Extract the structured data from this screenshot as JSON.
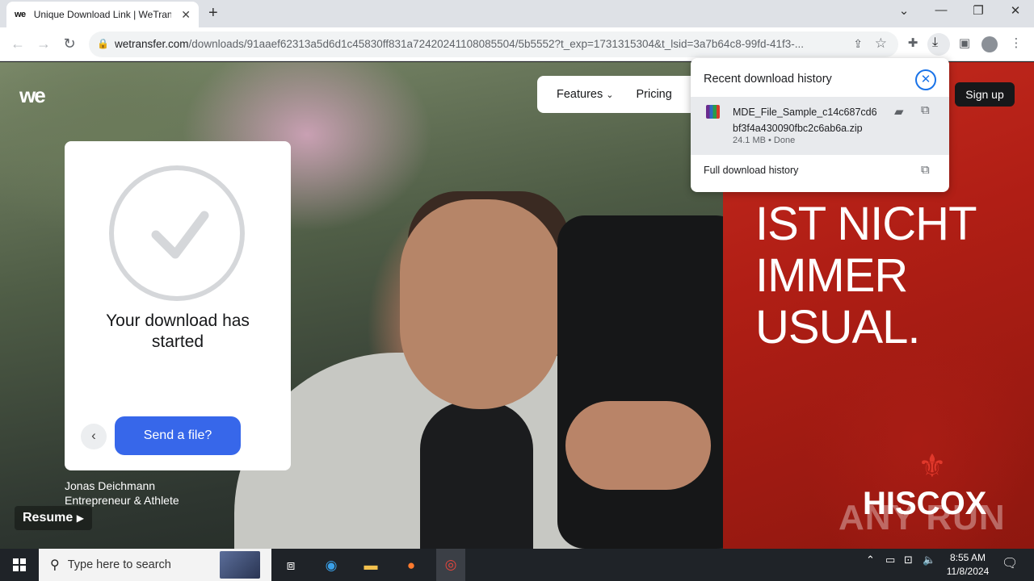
{
  "browser": {
    "tab_title": "Unique Download Link | WeTransfer",
    "tab_favicon": "we",
    "url_host": "wetransfer.com",
    "url_path": "/downloads/91aaef62313a5d6d1c45830ff831a72420241108085504/5b5552?t_exp=1731315304&t_lsid=3a7b64c8-99fd-41f3-..."
  },
  "page": {
    "logo": "we",
    "nav": {
      "features": "Features",
      "pricing": "Pricing"
    },
    "signup": "Sign up",
    "card": {
      "title": "Your download has started",
      "send_button": "Send a file?"
    },
    "credit": {
      "name": "Jonas Deichmann",
      "role": "Entrepreneur & Athlete"
    },
    "resume": "Resume",
    "ad": {
      "headline": "SS\nIST NICHT\nIMMER\nUSUAL.",
      "brand": "HISCOX",
      "watermark": "ANY RUN"
    }
  },
  "download_popup": {
    "title": "Recent download history",
    "file_name": "MDE_File_Sample_c14c687cd6bf3f4a430090fbc2c6ab6a.zip",
    "file_meta": "24.1 MB • Done",
    "full_history": "Full download history"
  },
  "taskbar": {
    "search_placeholder": "Type here to search",
    "time": "8:55 AM",
    "date": "11/8/2024"
  },
  "colors": {
    "send_button": "#3767ea",
    "ad_red": "#c42a1e",
    "popup_close": "#1a73e8"
  }
}
